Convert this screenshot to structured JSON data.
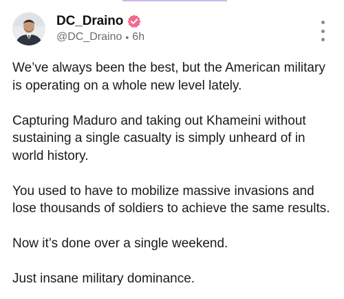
{
  "post": {
    "author": {
      "display_name": "DC_Draino",
      "handle": "@DC_Draino",
      "verified": true,
      "verified_color": "#f26a8d",
      "avatar": "user-avatar"
    },
    "time_ago": "6h",
    "separator": "•",
    "more_menu_icon": "vertical-ellipsis-icon",
    "paragraphs": [
      "We’ve always been the best, but the American military is operating on a whole new level lately.",
      "Capturing Maduro and taking out Khameini without sustaining a single casualty is simply unheard of in world history.",
      "You used to have to mobilize massive invasions and lose thousands of soldiers to achieve the same results.",
      "Now it’s done over a single weekend.",
      "Just insane military dominance."
    ]
  },
  "colors": {
    "text": "#1a1a1a",
    "muted": "#6b6b6b",
    "accent": "#c9b9e6"
  }
}
